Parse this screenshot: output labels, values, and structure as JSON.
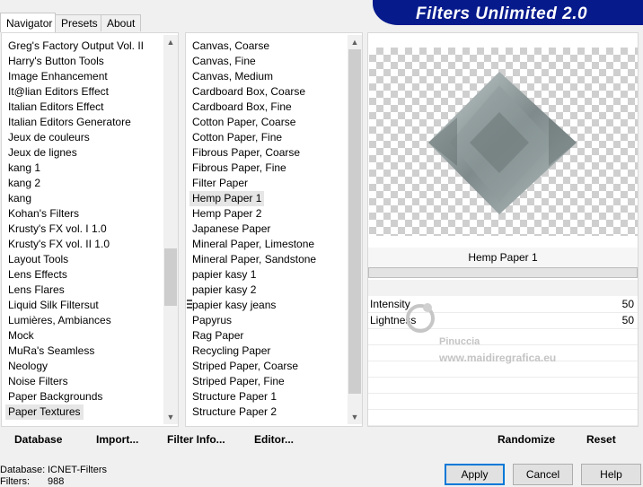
{
  "tabs": [
    {
      "label": "Navigator",
      "active": true
    },
    {
      "label": "Presets",
      "active": false
    },
    {
      "label": "About",
      "active": false
    }
  ],
  "banner": {
    "title": "Filters Unlimited 2.0"
  },
  "categories": [
    "Greg's Factory Output Vol. II",
    "Harry's Button Tools",
    "Image Enhancement",
    "It@lian Editors Effect",
    "Italian Editors Effect",
    "Italian Editors Generatore",
    "Jeux de couleurs",
    "Jeux de lignes",
    "kang 1",
    "kang 2",
    "kang",
    "Kohan's Filters",
    "Krusty's FX vol. I 1.0",
    "Krusty's FX vol. II 1.0",
    "Layout Tools",
    "Lens Effects",
    "Lens Flares",
    "Liquid Silk Filtersut",
    "Lumières, Ambiances",
    "Mock",
    "MuRa's Seamless",
    "Neology",
    "Noise Filters",
    "Paper Backgrounds",
    "Paper Textures"
  ],
  "categories_selected": "Paper Textures",
  "filters": [
    "Canvas, Coarse",
    "Canvas, Fine",
    "Canvas, Medium",
    "Cardboard Box, Coarse",
    "Cardboard Box, Fine",
    "Cotton Paper, Coarse",
    "Cotton Paper, Fine",
    "Fibrous Paper, Coarse",
    "Fibrous Paper, Fine",
    "Filter Paper",
    "Hemp Paper 1",
    "Hemp Paper 2",
    "Japanese Paper",
    "Mineral Paper, Limestone",
    "Mineral Paper, Sandstone",
    "papier kasy 1",
    "papier kasy 2",
    "papier kasy jeans",
    "Papyrus",
    "Rag Paper",
    "Recycling Paper",
    "Striped Paper, Coarse",
    "Striped Paper, Fine",
    "Structure Paper 1",
    "Structure Paper 2"
  ],
  "filters_selected": "Hemp Paper 1",
  "filter_name": "Hemp Paper 1",
  "params": [
    {
      "label": "Intensity",
      "value": "50"
    },
    {
      "label": "Lightness",
      "value": "50"
    }
  ],
  "watermark": {
    "line1": "Pinuccia",
    "line2": "www.maidiregrafica.eu"
  },
  "toolbar": {
    "database": "Database",
    "import": "Import...",
    "filter_info": "Filter Info...",
    "editor": "Editor...",
    "randomize": "Randomize",
    "reset": "Reset"
  },
  "status": {
    "database_label": "Database:",
    "database_value": "ICNET-Filters",
    "filters_label": "Filters:",
    "filters_value": "988"
  },
  "buttons": {
    "apply": "Apply",
    "cancel": "Cancel",
    "help": "Help"
  }
}
